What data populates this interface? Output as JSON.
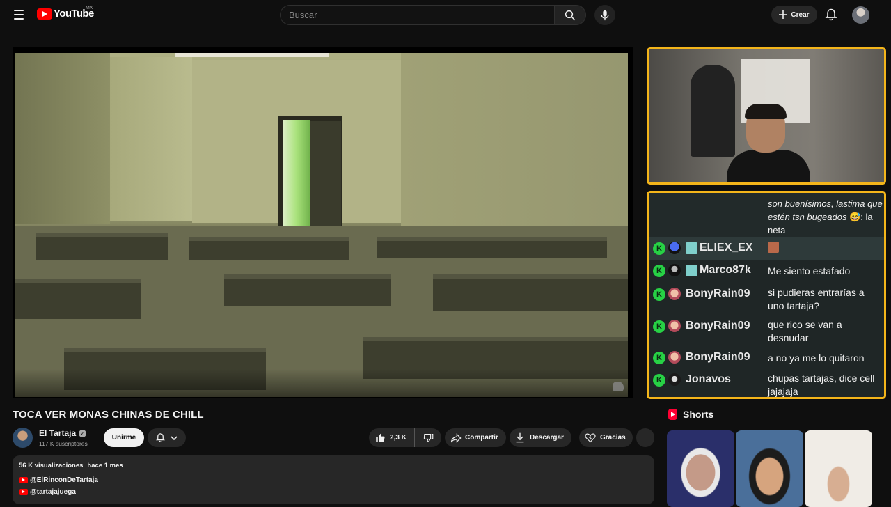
{
  "header": {
    "logo_text": "YouTube",
    "country_code": "MX",
    "search_placeholder": "Buscar",
    "create_label": "Crear"
  },
  "video": {
    "title": "TOCA VER MONAS CHINAS DE CHILL",
    "channel_name": "El Tartaja",
    "subscribers": "117 K suscriptores",
    "join_label": "Unirme",
    "likes": "2,3 K",
    "share_label": "Compartir",
    "download_label": "Descargar",
    "thanks_label": "Gracias"
  },
  "description": {
    "views": "56 K visualizaciones",
    "date": "hace 1 mes",
    "links": [
      "@ElRinconDeTartaja",
      "@tartajajuega"
    ]
  },
  "chat": {
    "partial_message": {
      "italic_text": "son buenísimos, lastima que estén tsn bugeados",
      "tail_text": ": la neta"
    },
    "rows": [
      {
        "user": "ELIEX_EX",
        "message": ""
      },
      {
        "user": "Marco87k",
        "message": "Me siento estafado"
      },
      {
        "user": "BonyRain09",
        "message": "si pudieras entrarías a uno tartaja?"
      },
      {
        "user": "BonyRain09",
        "message": "que rico se van a desnudar"
      },
      {
        "user": "BonyRain09",
        "message": "a no ya me lo quitaron"
      },
      {
        "user": "Jonavos",
        "message": "chupas tartajas, dice cell jajajaja"
      }
    ],
    "badge_letter": "K"
  },
  "shorts": {
    "heading": "Shorts"
  },
  "colors": {
    "accent_red": "#ff0000",
    "overlay_border": "#f4b51a",
    "chat_badge_green": "#27d145"
  }
}
